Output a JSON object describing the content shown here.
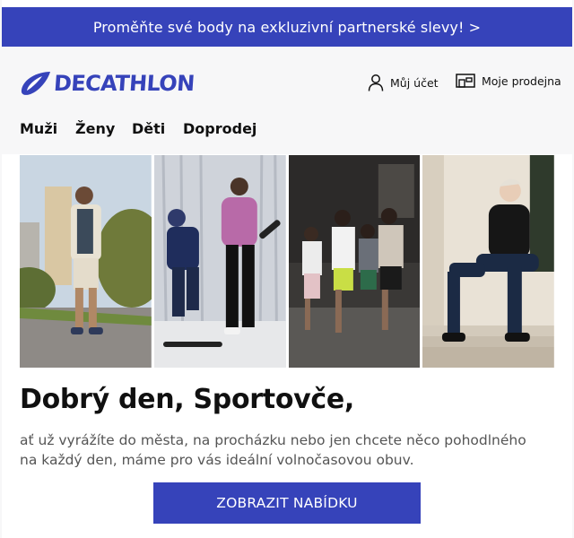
{
  "promo_banner": {
    "text": "Proměňte své body na exkluzivní partnerské slevy! >"
  },
  "brand": {
    "name": "DECATHLON",
    "color": "#3643ba"
  },
  "header": {
    "account_label": "Můj účet",
    "account_icon": "user-icon",
    "store_label": "Moje prodejna",
    "store_icon": "store-icon"
  },
  "nav": {
    "items": [
      "Muži",
      "Ženy",
      "Děti",
      "Doprodej"
    ]
  },
  "gallery": {
    "images": [
      {
        "name": "man-walking-city-photo"
      },
      {
        "name": "skateboard-couple-photo"
      },
      {
        "name": "group-street-photo"
      },
      {
        "name": "man-sitting-steps-photo"
      }
    ]
  },
  "content": {
    "greeting": "Dobrý den, Sportovče,",
    "body": "ať už vyrážíte do města, na procházku nebo jen chcete něco pohodlného na každý den, máme pro vás ideální volnočasovou obuv.",
    "cta_label": "ZOBRAZIT NABÍDKU"
  },
  "colors": {
    "accent": "#3643ba",
    "text": "#101010",
    "muted": "#555555",
    "background": "#f7f7f8"
  }
}
